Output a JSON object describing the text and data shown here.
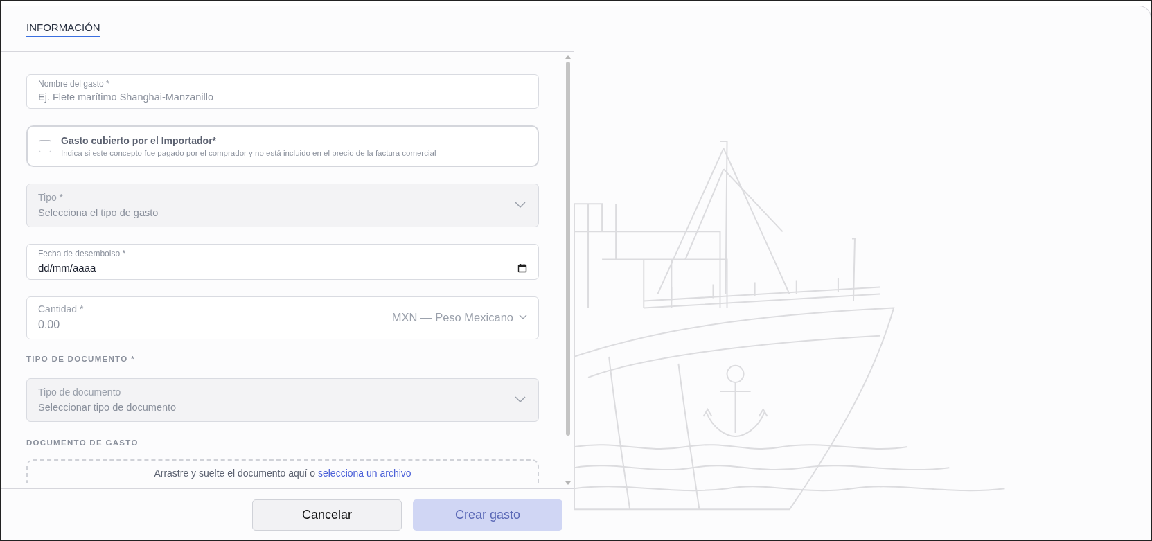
{
  "tabs": [
    {
      "label": "INFORMACIÓN",
      "selected": true
    }
  ],
  "form": [
    {
      "kind": "text",
      "label": "Nombre del gasto *",
      "placeholder": "Ej. Flete marítimo Shanghai-Manzanillo"
    },
    {
      "kind": "checkbox",
      "label": "Gasto cubierto por el Importador*",
      "hint": "Indica si este concepto fue pagado por el comprador y no está incluido en el precio de la factura comercial",
      "checked": false
    },
    {
      "kind": "select",
      "label": "Tipo *",
      "placeholder": "Selecciona el tipo de gasto",
      "disabled": true
    },
    {
      "kind": "date",
      "label": "Fecha de desembolso *",
      "value": "dd/mm/aaaa"
    },
    {
      "kind": "amount",
      "label": "Cantidad *",
      "placeholder": "0.00",
      "currency": "MXN — Peso Mexicano"
    },
    {
      "kind": "section",
      "label": "TIPO DE DOCUMENTO *"
    },
    {
      "kind": "select",
      "label": "Tipo de documento",
      "placeholder": "Seleccionar tipo de documento",
      "disabled": true
    },
    {
      "kind": "section",
      "label": "DOCUMENTO DE GASTO"
    },
    {
      "kind": "dropzone",
      "text": "Arrastre y suelte el documento aquí o",
      "link": "selecciona un archivo"
    }
  ],
  "buttons": [
    {
      "label": "Cancelar",
      "kind": "secondary",
      "disabled": false
    },
    {
      "label": "Crear gasto",
      "kind": "primary",
      "disabled": true
    }
  ]
}
